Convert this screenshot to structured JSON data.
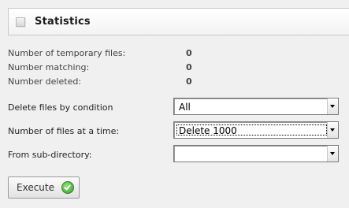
{
  "header": {
    "title": "Statistics"
  },
  "stats": [
    {
      "label": "Number of temporary files:",
      "value": "0"
    },
    {
      "label": "Number matching:",
      "value": "0"
    },
    {
      "label": "Number deleted:",
      "value": "0"
    }
  ],
  "options": {
    "condition": {
      "label": "Delete files by condition",
      "value": "All"
    },
    "batch": {
      "label": "Number of files at a time:",
      "value": "Delete 1000"
    },
    "subdir": {
      "label": "From sub-directory:",
      "value": ""
    }
  },
  "execute": {
    "label": "Execute",
    "icon": "check-icon",
    "icon_color": "#4caf35"
  }
}
